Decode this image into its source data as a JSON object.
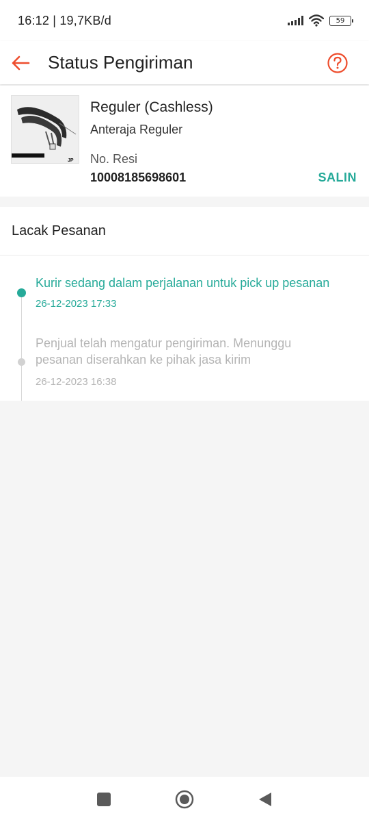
{
  "status_bar": {
    "time_speed": "16:12 | 19,7KB/d",
    "battery": "59"
  },
  "app_bar": {
    "title": "Status Pengiriman",
    "back_icon": "arrow-left-icon",
    "help_icon": "question-circle-icon"
  },
  "shipment": {
    "service": "Reguler (Cashless)",
    "courier": "Anteraja Reguler",
    "resi_label": "No. Resi",
    "resi_number": "10008185698601",
    "copy_label": "SALIN"
  },
  "tracking": {
    "header": "Lacak Pesanan",
    "events": [
      {
        "description": "Kurir sedang dalam perjalanan untuk pick up pesanan",
        "timestamp": "26-12-2023 17:33",
        "active": true
      },
      {
        "description": "Penjual telah mengatur pengiriman. Menunggu pesanan diserahkan ke pihak jasa kirim",
        "timestamp": "26-12-2023 16:38",
        "active": false
      }
    ]
  },
  "colors": {
    "accent_orange": "#ee4d2d",
    "accent_teal": "#26aa99",
    "inactive_gray": "#b5b5b5"
  },
  "nav": {
    "recent_icon": "square-icon",
    "home_icon": "circle-home-icon",
    "back_icon": "triangle-back-icon"
  }
}
